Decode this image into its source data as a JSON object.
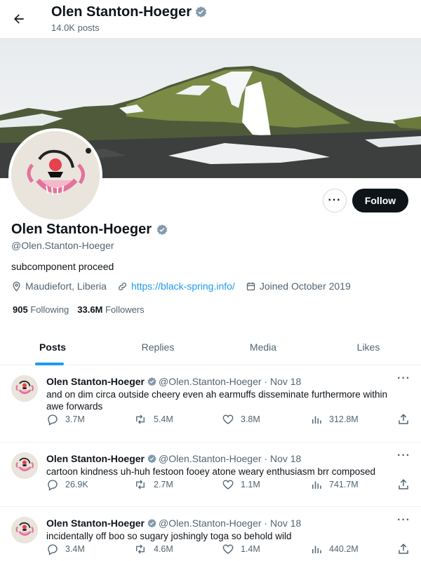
{
  "header": {
    "name": "Olen Stanton-Hoeger",
    "posts_count": "14.0K posts"
  },
  "profile": {
    "name": "Olen Stanton-Hoeger",
    "handle": "@Olen.Stanton-Hoeger",
    "bio": "subcomponent proceed",
    "location": "Maudiefort, Liberia",
    "website": "https://black-spring.info/",
    "joined": "Joined October 2019",
    "following_count": "905",
    "following_label": "Following",
    "followers_count": "33.6M",
    "followers_label": "Followers",
    "follow_label": "Follow",
    "more_label": "···"
  },
  "tabs": [
    {
      "label": "Posts",
      "active": true
    },
    {
      "label": "Replies",
      "active": false
    },
    {
      "label": "Media",
      "active": false
    },
    {
      "label": "Likes",
      "active": false
    }
  ],
  "posts": [
    {
      "name": "Olen Stanton-Hoeger",
      "handle": "@Olen.Stanton-Hoeger",
      "date": "· Nov 18",
      "text": "and on dim circa outside cheery even ah earmuffs disseminate furthermore within awe forwards",
      "replies": "3.7M",
      "reposts": "5.4M",
      "likes": "3.8M",
      "views": "312.8M"
    },
    {
      "name": "Olen Stanton-Hoeger",
      "handle": "@Olen.Stanton-Hoeger",
      "date": "· Nov 18",
      "text": "cartoon kindness uh-huh festoon fooey atone weary enthusiasm brr composed",
      "replies": "26.9K",
      "reposts": "2.7M",
      "likes": "1.1M",
      "views": "741.7M"
    },
    {
      "name": "Olen Stanton-Hoeger",
      "handle": "@Olen.Stanton-Hoeger",
      "date": "· Nov 18",
      "text": "incidentally off boo so sugary joshingly toga so behold wild",
      "replies": "3.4M",
      "reposts": "4.6M",
      "likes": "1.4M",
      "views": "440.2M"
    }
  ],
  "colors": {
    "accent": "#1d9bf0",
    "text": "#0f1419",
    "muted": "#536471",
    "verified": "#829aab"
  },
  "icons": [
    "back-arrow-icon",
    "verified-badge-icon",
    "location-icon",
    "link-icon",
    "calendar-icon",
    "reply-icon",
    "repost-icon",
    "like-icon",
    "views-icon",
    "share-icon",
    "more-icon"
  ]
}
